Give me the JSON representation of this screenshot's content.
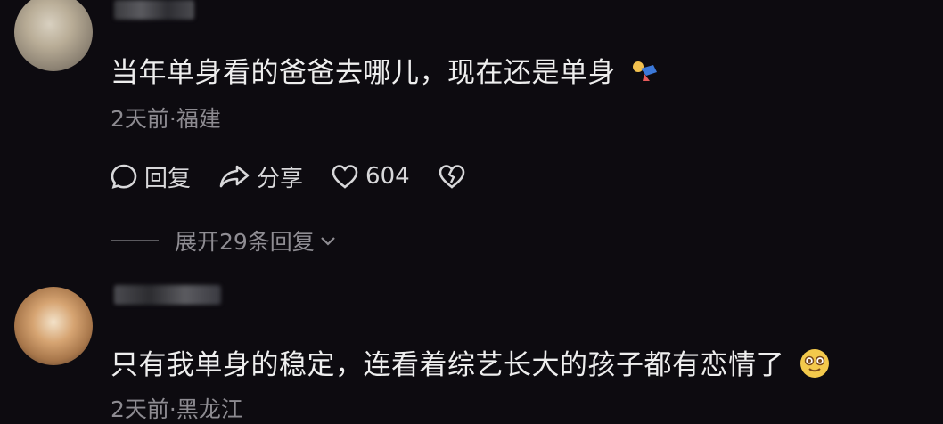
{
  "comments": [
    {
      "text": "当年单身看的爸爸去哪儿，现在还是单身",
      "meta": "2天前·福建",
      "actions": {
        "reply": "回复",
        "share": "分享",
        "likes": "604"
      },
      "expand_replies": "展开29条回复"
    },
    {
      "text": "只有我单身的稳定，连看着综艺长大的孩子都有恋情了",
      "meta": "2天前·黑龙江"
    }
  ]
}
